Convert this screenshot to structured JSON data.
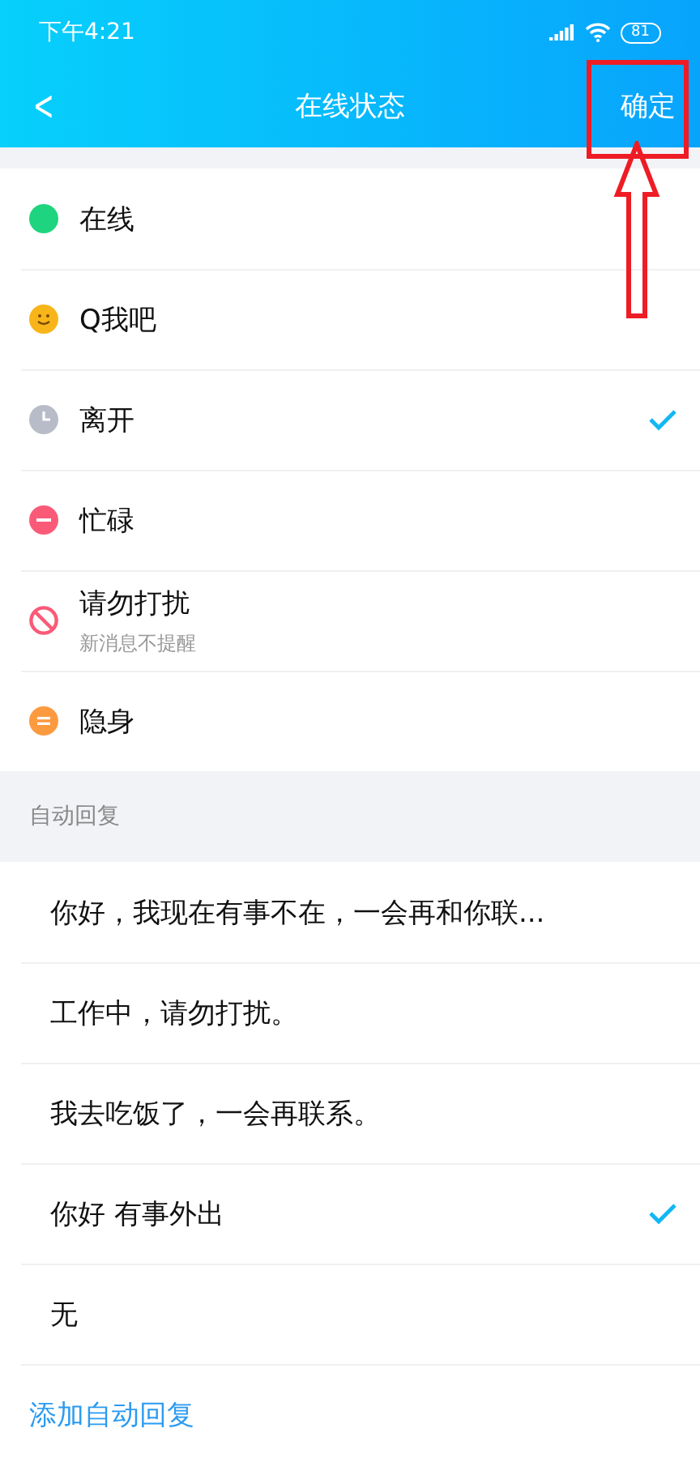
{
  "status_bar": {
    "time": "下午4:21",
    "battery": "81"
  },
  "nav": {
    "back": "<",
    "title": "在线状态",
    "confirm": "确定"
  },
  "statuses": [
    {
      "kind": "online",
      "label": "在线",
      "selected": false
    },
    {
      "kind": "smile",
      "label": "Q我吧",
      "selected": false
    },
    {
      "kind": "away",
      "label": "离开",
      "selected": true
    },
    {
      "kind": "busy",
      "label": "忙碌",
      "selected": false
    },
    {
      "kind": "dnd",
      "label": "请勿打扰",
      "sublabel": "新消息不提醒",
      "selected": false
    },
    {
      "kind": "invisible",
      "label": "隐身",
      "selected": false
    }
  ],
  "auto_reply": {
    "header": "自动回复",
    "replies": [
      {
        "text": "你好，我现在有事不在，一会再和你联...",
        "selected": false
      },
      {
        "text": "工作中，请勿打扰。",
        "selected": false
      },
      {
        "text": "我去吃饭了，一会再联系。",
        "selected": false
      },
      {
        "text": "你好 有事外出",
        "selected": true
      },
      {
        "text": "无",
        "selected": false
      }
    ],
    "add": "添加自动回复"
  }
}
